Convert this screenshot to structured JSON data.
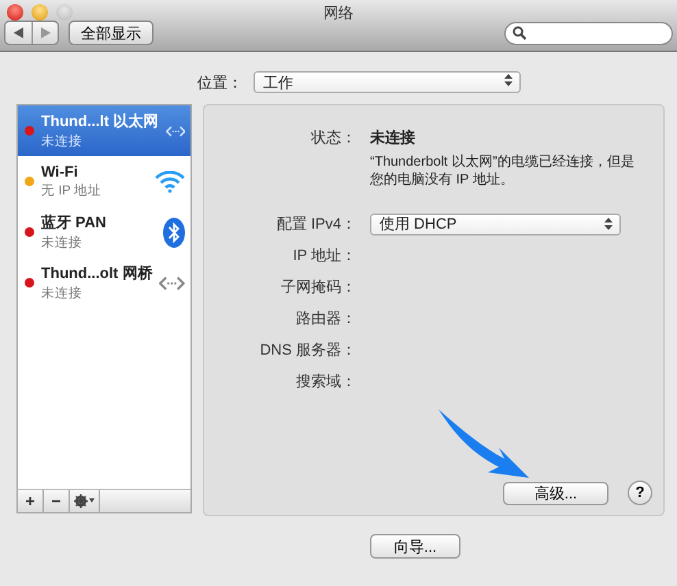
{
  "window": {
    "title": "网络"
  },
  "toolbar": {
    "show_all": "全部显示"
  },
  "location": {
    "label": "位置：",
    "value": "工作"
  },
  "services": [
    {
      "name": "Thund...lt 以太网",
      "status": "未连接",
      "color": "#d8151b",
      "selected": true,
      "kind": "ethernet"
    },
    {
      "name": "Wi-Fi",
      "status": "无 IP 地址",
      "color": "#f0a818",
      "selected": false,
      "kind": "wifi"
    },
    {
      "name": "蓝牙 PAN",
      "status": "未连接",
      "color": "#d8151b",
      "selected": false,
      "kind": "bluetooth"
    },
    {
      "name": "Thund...olt 网桥",
      "status": "未连接",
      "color": "#d8151b",
      "selected": false,
      "kind": "ethernet"
    }
  ],
  "list_buttons": [
    "+",
    "−"
  ],
  "detail": {
    "status_label": "状态：",
    "status_value": "未连接",
    "status_description": "“Thunderbolt 以太网”的电缆已经连接，但是您的电脑没有 IP 地址。",
    "fields": [
      {
        "label": "配置 IPv4：",
        "kind": "select",
        "value": "使用 DHCP"
      },
      {
        "label": "IP 地址：",
        "kind": "empty"
      },
      {
        "label": "子网掩码：",
        "kind": "empty"
      },
      {
        "label": "路由器：",
        "kind": "empty"
      },
      {
        "label": "DNS 服务器：",
        "kind": "empty"
      },
      {
        "label": "搜索域：",
        "kind": "empty"
      }
    ]
  },
  "buttons": {
    "advanced": "高级...",
    "help": "?",
    "assistant": "向导..."
  }
}
